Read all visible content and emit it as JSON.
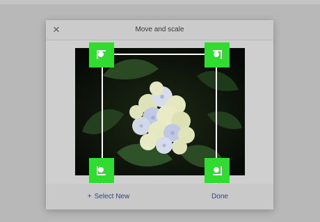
{
  "dialog": {
    "title": "Move and scale",
    "close_icon": "close-icon",
    "close_glyph": "✕"
  },
  "footer": {
    "select_new_icon": "plus-icon",
    "select_new_glyph": "+",
    "select_new_label": "Select New",
    "done_label": "Done"
  },
  "colors": {
    "handle": "#2fdc2f",
    "crop_frame": "#ffffff",
    "button_text": "#33457a",
    "dialog_bg": "#cfcfcf"
  },
  "image": {
    "subject": "hydrangea flower photo"
  }
}
